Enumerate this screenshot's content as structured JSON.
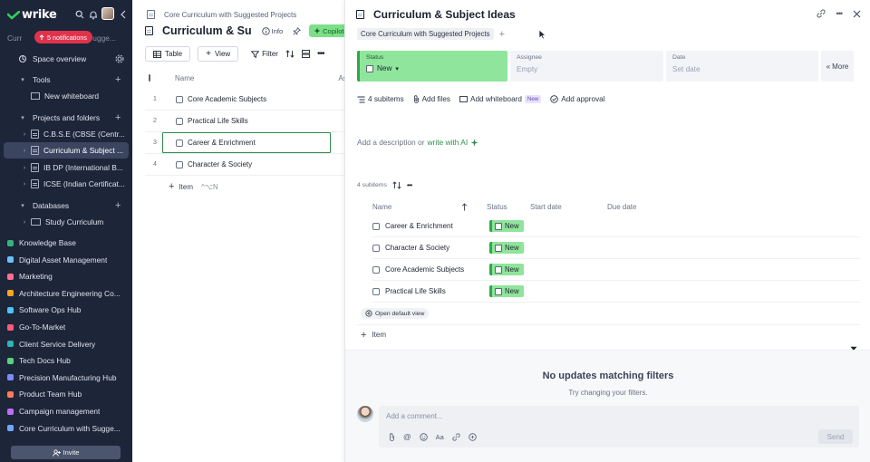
{
  "sidebar": {
    "logo_text": "wrike",
    "notifications_label": "5 notifications",
    "crumb_partial": "Curr",
    "crumb_partial_end": "ugge...",
    "space_overview": "Space overview",
    "tools_label": "Tools",
    "new_whiteboard": "New whiteboard",
    "projects_label": "Projects and folders",
    "folders": [
      {
        "label": "C.B.S.E (CBSE (Centr..."
      },
      {
        "label": "Curriculum & Subject ..."
      },
      {
        "label": "IB DP (International B..."
      },
      {
        "label": "ICSE (Indian Certificat..."
      }
    ],
    "databases_label": "Databases",
    "study_curriculum": "Study Curriculum",
    "spaces": [
      {
        "label": "Knowledge Base",
        "color": "#36b37e"
      },
      {
        "label": "Digital Asset Management",
        "color": "#6bc1ff"
      },
      {
        "label": "Marketing",
        "color": "#ff6f91"
      },
      {
        "label": "Architecture Engineering Co...",
        "color": "#f5a623"
      },
      {
        "label": "Software Ops Hub",
        "color": "#4fc3f7"
      },
      {
        "label": "Go-To-Market",
        "color": "#ff5a7a"
      },
      {
        "label": "Client Service Delivery",
        "color": "#2db3b3"
      },
      {
        "label": "Tech Docs Hub",
        "color": "#5ad17c"
      },
      {
        "label": "Precision Manufacturing Hub",
        "color": "#7c8cff"
      },
      {
        "label": "Product Team Hub",
        "color": "#ff7a59"
      },
      {
        "label": "Campaign management",
        "color": "#c06cff"
      },
      {
        "label": "Core Curriculum with Sugge...",
        "color": "#6ea8ff"
      }
    ],
    "invite_label": "Invite"
  },
  "middle": {
    "breadcrumb": "Core Curriculum with Suggested Projects",
    "title": "Curriculum & Su",
    "info_label": "Info",
    "copilot_label": "Copilot",
    "table_label": "Table",
    "view_label": "View",
    "filter_label": "Filter",
    "col_name": "Name",
    "col_partial": "As",
    "rows": [
      {
        "num": "1",
        "name": "Core Academic Subjects"
      },
      {
        "num": "2",
        "name": "Practical Life Skills"
      },
      {
        "num": "3",
        "name": "Career & Enrichment"
      },
      {
        "num": "4",
        "name": "Character & Society"
      }
    ],
    "add_item_label": "Item",
    "add_item_shortcut": "^⌥N"
  },
  "panel": {
    "title": "Curriculum & Subject Ideas",
    "parent_chip": "Core Curriculum with Suggested Projects",
    "fields": {
      "status_label": "Status",
      "status_value": "New",
      "assignee_label": "Assignee",
      "assignee_value": "Empty",
      "date_label": "Date",
      "date_value": "Set date",
      "more_label": "More"
    },
    "meta": {
      "subitems": "4 subitems",
      "add_files": "Add files",
      "add_whiteboard": "Add whiteboard",
      "new_badge": "New",
      "add_approval": "Add approval"
    },
    "description": {
      "prefix": "Add a description or",
      "link": "write with AI"
    },
    "subitems_head": "4 subitems",
    "subtable": {
      "col_name": "Name",
      "col_status": "Status",
      "col_start": "Start date",
      "col_due": "Due date",
      "rows": [
        {
          "name": "Career & Enrichment",
          "status": "New"
        },
        {
          "name": "Character & Society",
          "status": "New"
        },
        {
          "name": "Core Academic Subjects",
          "status": "New"
        },
        {
          "name": "Practical Life Skills",
          "status": "New"
        }
      ]
    },
    "open_default_view": "Open default view",
    "add_subitem": "Item",
    "updates": {
      "title": "No updates matching filters",
      "subtitle": "Try changing your filters.",
      "comment_placeholder": "Add a comment...",
      "send_label": "Send",
      "format_label": "Aa"
    },
    "colors": {
      "status_green": "#8fe59b",
      "status_dark_green": "#2fa749",
      "accent_link": "#2e8b4a",
      "sidebar_bg": "#1d2539",
      "notification_red": "#e0334b"
    }
  }
}
